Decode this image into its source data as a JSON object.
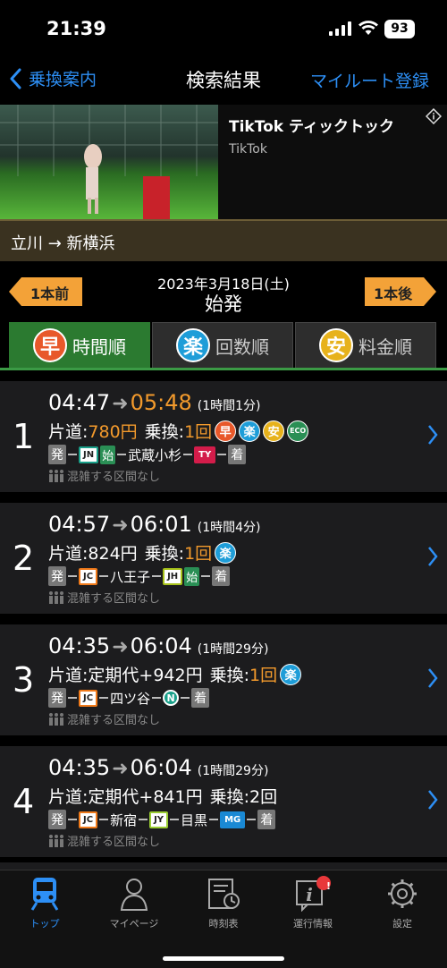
{
  "status": {
    "time": "21:39",
    "battery": "93"
  },
  "nav": {
    "back_label": "乗換案内",
    "title": "検索結果",
    "right_label": "マイルート登録"
  },
  "ad": {
    "title": "TikTok ティックトック",
    "subtitle": "TikTok"
  },
  "route": {
    "text": "立川 → 新横浜"
  },
  "date_nav": {
    "prev": "1本前",
    "next": "1本後",
    "date": "2023年3月18日(土)",
    "mode": "始発"
  },
  "tabs": [
    {
      "icon": "早",
      "label": "時間順",
      "color": "#e8582a",
      "active": true
    },
    {
      "icon": "楽",
      "label": "回数順",
      "color": "#1e9dd8",
      "active": false
    },
    {
      "icon": "安",
      "label": "料金順",
      "color": "#e7b21c",
      "active": false
    }
  ],
  "results": [
    {
      "num": "1",
      "depart": "04:47",
      "arrive": "05:48",
      "duration": "(1時間1分)",
      "fare_label": "片道:",
      "fare": "780円",
      "transfer_label": "乗換:",
      "transfer": "1回",
      "badges": [
        "早",
        "楽",
        "安",
        "ECO"
      ],
      "route": {
        "start": "発",
        "l1": "JN",
        "s1": "始",
        "station1": "武蔵小杉",
        "l2": "TY",
        "end": "着"
      },
      "crowd": "混雑する区間なし"
    },
    {
      "num": "2",
      "depart": "04:57",
      "arrive": "06:01",
      "duration": "(1時間4分)",
      "fare_label": "片道:",
      "fare": "824円",
      "transfer_label": "乗換:",
      "transfer": "1回",
      "badges": [
        "楽"
      ],
      "route": {
        "start": "発",
        "l1": "JC",
        "station1": "八王子",
        "l2": "JH",
        "s2": "始",
        "end": "着"
      },
      "crowd": "混雑する区間なし"
    },
    {
      "num": "3",
      "depart": "04:35",
      "arrive": "06:04",
      "duration": "(1時間29分)",
      "fare_label": "片道:",
      "fare": "定期代+942円",
      "transfer_label": "乗換:",
      "transfer": "1回",
      "badges": [
        "楽"
      ],
      "route": {
        "start": "発",
        "l1": "JC",
        "station1": "四ツ谷",
        "l2": "N",
        "end": "着"
      },
      "crowd": "混雑する区間なし"
    },
    {
      "num": "4",
      "depart": "04:35",
      "arrive": "06:04",
      "duration": "(1時間29分)",
      "fare_label": "片道:",
      "fare": "定期代+841円",
      "transfer_label": "乗換:",
      "transfer": "2回",
      "route": {
        "start": "発",
        "l1": "JC",
        "station1": "新宿",
        "l2": "JY",
        "station2": "目黒",
        "l3": "MG",
        "end": "着"
      },
      "crowd": "混雑する区間なし"
    }
  ],
  "tabbar": [
    {
      "label": "トップ",
      "icon": "train-icon",
      "active": true
    },
    {
      "label": "マイページ",
      "icon": "person-icon"
    },
    {
      "label": "時刻表",
      "icon": "timetable-icon"
    },
    {
      "label": "運行情報",
      "icon": "info-icon",
      "badge": "!"
    },
    {
      "label": "設定",
      "icon": "gear-icon"
    }
  ]
}
